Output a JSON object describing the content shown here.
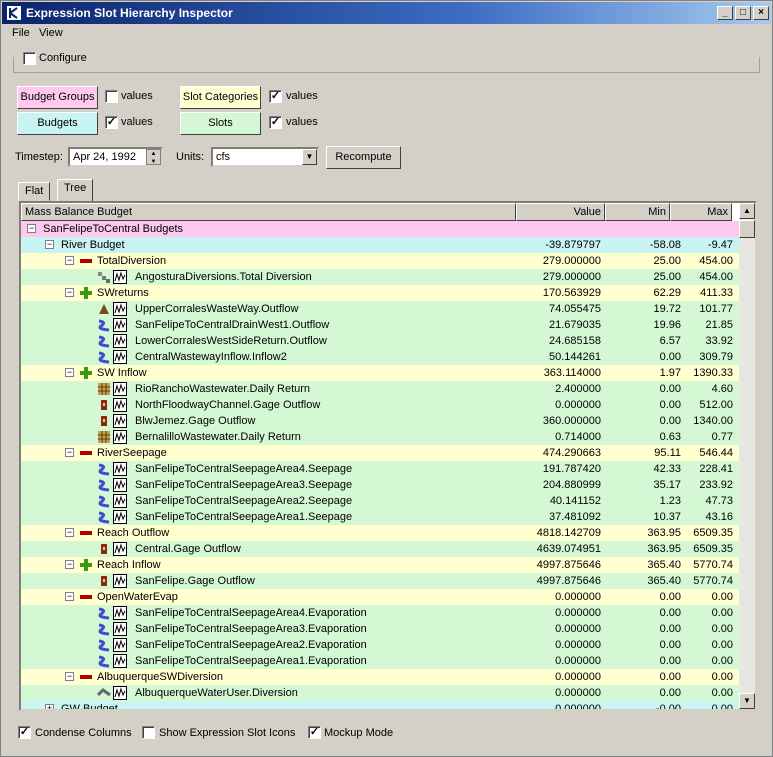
{
  "window": {
    "title": "Expression Slot Hierarchy Inspector"
  },
  "menu": [
    "File",
    "View"
  ],
  "configure": {
    "label": "Configure",
    "checked": false
  },
  "legend": {
    "budget_groups": {
      "label": "Budget Groups",
      "values_label": "values",
      "checked": false
    },
    "budgets": {
      "label": "Budgets",
      "values_label": "values",
      "checked": true
    },
    "slot_categories": {
      "label": "Slot Categories",
      "values_label": "values",
      "checked": true
    },
    "slots": {
      "label": "Slots",
      "values_label": "values",
      "checked": true
    }
  },
  "controls": {
    "timestep_label": "Timestep:",
    "timestep_value": "Apr 24, 1992",
    "units_label": "Units:",
    "units_value": "cfs",
    "recompute": "Recompute"
  },
  "tabs": [
    "Flat",
    "Tree"
  ],
  "tree": {
    "columns": [
      "Mass Balance Budget",
      "Value",
      "Min",
      "Max"
    ],
    "rows": [
      {
        "level": 0,
        "type": "group",
        "exp": "minus",
        "icon": "",
        "name": "SanFelipeToCentral Budgets",
        "value": "",
        "min": "",
        "max": ""
      },
      {
        "level": 1,
        "type": "budget",
        "exp": "minus",
        "icon": "",
        "name": "River Budget",
        "value": "-39.879797",
        "min": "-58.08",
        "max": "-9.47"
      },
      {
        "level": 2,
        "type": "category",
        "exp": "minus",
        "icon": "minus-sign-icon",
        "name": "TotalDiversion",
        "value": "279.000000",
        "min": "25.00",
        "max": "454.00"
      },
      {
        "level": 3,
        "type": "slot",
        "exp": "",
        "icon": "diversion-icon",
        "name": "AngosturaDiversions.Total Diversion",
        "value": "279.000000",
        "min": "25.00",
        "max": "454.00"
      },
      {
        "level": 2,
        "type": "category",
        "exp": "minus",
        "icon": "plus-sign-icon",
        "name": "SWreturns",
        "value": "170.563929",
        "min": "62.29",
        "max": "411.33"
      },
      {
        "level": 3,
        "type": "slot",
        "exp": "",
        "icon": "wasteway-icon",
        "name": "UpperCorralesWasteWay.Outflow",
        "value": "74.055475",
        "min": "19.72",
        "max": "101.77"
      },
      {
        "level": 3,
        "type": "slot",
        "exp": "",
        "icon": "reach-icon",
        "name": "SanFelipeToCentralDrainWest1.Outflow",
        "value": "21.679035",
        "min": "19.96",
        "max": "21.85"
      },
      {
        "level": 3,
        "type": "slot",
        "exp": "",
        "icon": "reach-icon",
        "name": "LowerCorralesWestSideReturn.Outflow",
        "value": "24.685158",
        "min": "6.57",
        "max": "33.92"
      },
      {
        "level": 3,
        "type": "slot",
        "exp": "",
        "icon": "reach-icon",
        "name": "CentralWastewayInflow.Inflow2",
        "value": "50.144261",
        "min": "0.00",
        "max": "309.79"
      },
      {
        "level": 2,
        "type": "category",
        "exp": "minus",
        "icon": "plus-sign-icon",
        "name": "SW Inflow",
        "value": "363.114000",
        "min": "1.97",
        "max": "1390.33"
      },
      {
        "level": 3,
        "type": "slot",
        "exp": "",
        "icon": "city-icon",
        "name": "RioRanchoWastewater.Daily Return",
        "value": "2.400000",
        "min": "0.00",
        "max": "4.60"
      },
      {
        "level": 3,
        "type": "slot",
        "exp": "",
        "icon": "gage-icon",
        "name": "NorthFloodwayChannel.Gage Outflow",
        "value": "0.000000",
        "min": "0.00",
        "max": "512.00"
      },
      {
        "level": 3,
        "type": "slot",
        "exp": "",
        "icon": "gage-icon",
        "name": "BlwJemez.Gage Outflow",
        "value": "360.000000",
        "min": "0.00",
        "max": "1340.00"
      },
      {
        "level": 3,
        "type": "slot",
        "exp": "",
        "icon": "city-icon",
        "name": "BernalilloWastewater.Daily Return",
        "value": "0.714000",
        "min": "0.63",
        "max": "0.77"
      },
      {
        "level": 2,
        "type": "category",
        "exp": "minus",
        "icon": "minus-sign-icon",
        "name": "RiverSeepage",
        "value": "474.290663",
        "min": "95.11",
        "max": "546.44"
      },
      {
        "level": 3,
        "type": "slot",
        "exp": "",
        "icon": "reach-icon",
        "name": "SanFelipeToCentralSeepageArea4.Seepage",
        "value": "191.787420",
        "min": "42.33",
        "max": "228.41"
      },
      {
        "level": 3,
        "type": "slot",
        "exp": "",
        "icon": "reach-icon",
        "name": "SanFelipeToCentralSeepageArea3.Seepage",
        "value": "204.880999",
        "min": "35.17",
        "max": "233.92"
      },
      {
        "level": 3,
        "type": "slot",
        "exp": "",
        "icon": "reach-icon",
        "name": "SanFelipeToCentralSeepageArea2.Seepage",
        "value": "40.141152",
        "min": "1.23",
        "max": "47.73"
      },
      {
        "level": 3,
        "type": "slot",
        "exp": "",
        "icon": "reach-icon",
        "name": "SanFelipeToCentralSeepageArea1.Seepage",
        "value": "37.481092",
        "min": "10.37",
        "max": "43.16"
      },
      {
        "level": 2,
        "type": "category",
        "exp": "minus",
        "icon": "minus-sign-icon",
        "name": "Reach Outflow",
        "value": "4818.142709",
        "min": "363.95",
        "max": "6509.35"
      },
      {
        "level": 3,
        "type": "slot",
        "exp": "",
        "icon": "gage-icon",
        "name": "Central.Gage Outflow",
        "value": "4639.074951",
        "min": "363.95",
        "max": "6509.35"
      },
      {
        "level": 2,
        "type": "category",
        "exp": "minus",
        "icon": "plus-sign-icon",
        "name": "Reach Inflow",
        "value": "4997.875646",
        "min": "365.40",
        "max": "5770.74"
      },
      {
        "level": 3,
        "type": "slot",
        "exp": "",
        "icon": "gage-icon",
        "name": "SanFelipe.Gage Outflow",
        "value": "4997.875646",
        "min": "365.40",
        "max": "5770.74"
      },
      {
        "level": 2,
        "type": "category",
        "exp": "minus",
        "icon": "minus-sign-icon",
        "name": "OpenWaterEvap",
        "value": "0.000000",
        "min": "0.00",
        "max": "0.00"
      },
      {
        "level": 3,
        "type": "slot",
        "exp": "",
        "icon": "reach-icon",
        "name": "SanFelipeToCentralSeepageArea4.Evaporation",
        "value": "0.000000",
        "min": "0.00",
        "max": "0.00"
      },
      {
        "level": 3,
        "type": "slot",
        "exp": "",
        "icon": "reach-icon",
        "name": "SanFelipeToCentralSeepageArea3.Evaporation",
        "value": "0.000000",
        "min": "0.00",
        "max": "0.00"
      },
      {
        "level": 3,
        "type": "slot",
        "exp": "",
        "icon": "reach-icon",
        "name": "SanFelipeToCentralSeepageArea2.Evaporation",
        "value": "0.000000",
        "min": "0.00",
        "max": "0.00"
      },
      {
        "level": 3,
        "type": "slot",
        "exp": "",
        "icon": "reach-icon",
        "name": "SanFelipeToCentralSeepageArea1.Evaporation",
        "value": "0.000000",
        "min": "0.00",
        "max": "0.00"
      },
      {
        "level": 2,
        "type": "category",
        "exp": "minus",
        "icon": "minus-sign-icon",
        "name": "AlbuquerqueSWDiversion",
        "value": "0.000000",
        "min": "0.00",
        "max": "0.00"
      },
      {
        "level": 3,
        "type": "slot",
        "exp": "",
        "icon": "water-user-icon",
        "name": "AlbuquerqueWaterUser.Diversion",
        "value": "0.000000",
        "min": "0.00",
        "max": "0.00"
      },
      {
        "level": 1,
        "type": "budget",
        "exp": "plus",
        "icon": "",
        "name": "GW Budget",
        "value": "0.000000",
        "min": "-0.00",
        "max": "0.00"
      }
    ]
  },
  "footer": {
    "condense": {
      "label": "Condense Columns",
      "checked": true
    },
    "show_icons": {
      "label": "Show Expression Slot Icons",
      "checked": false
    },
    "mockup": {
      "label": "Mockup Mode",
      "checked": true
    }
  },
  "colors": {
    "group": "#ffc8f0",
    "budget": "#c8f4f4",
    "category": "#ffffd0",
    "slot": "#d4f8d4"
  }
}
